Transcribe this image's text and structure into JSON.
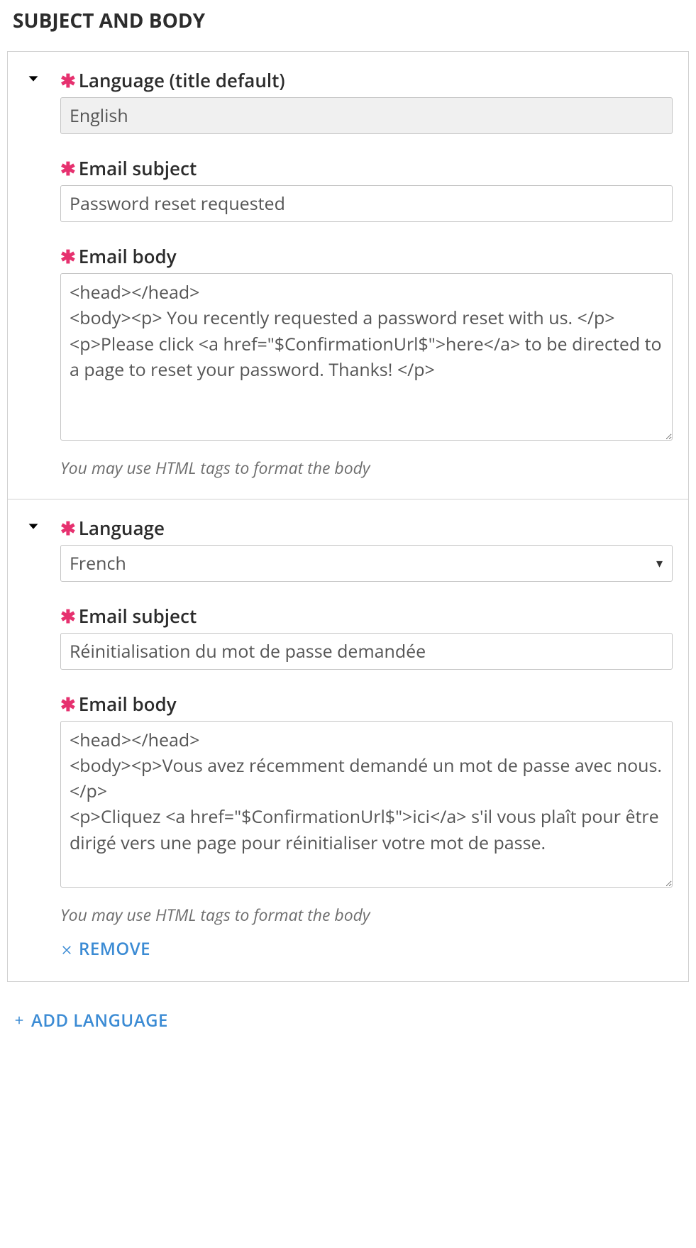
{
  "section_title": "SUBJECT AND BODY",
  "labels": {
    "language_default": "Language (title default)",
    "language": "Language",
    "email_subject": "Email subject",
    "email_body": "Email body",
    "help_text": "You may use HTML tags to format the body",
    "remove": "REMOVE",
    "add_language": "ADD LANGUAGE"
  },
  "blocks": [
    {
      "is_default": true,
      "language_value": "English",
      "subject_value": "Password reset requested",
      "body_value": "<head></head>\n<body><p> You recently requested a password reset with us. </p>\n<p>Please click <a href=\"$ConfirmationUrl$\">here</a> to be directed to a page to reset your password. Thanks! </p>",
      "removable": false
    },
    {
      "is_default": false,
      "language_value": "French",
      "subject_value": "Réinitialisation du mot de passe demandée",
      "body_value": "<head></head>\n<body><p>Vous avez récemment demandé un mot de passe avec nous. </p>\n<p>Cliquez <a href=\"$ConfirmationUrl$\">ici</a> s'il vous plaît pour être dirigé vers une page pour réinitialiser votre mot de passe.",
      "removable": true
    }
  ]
}
